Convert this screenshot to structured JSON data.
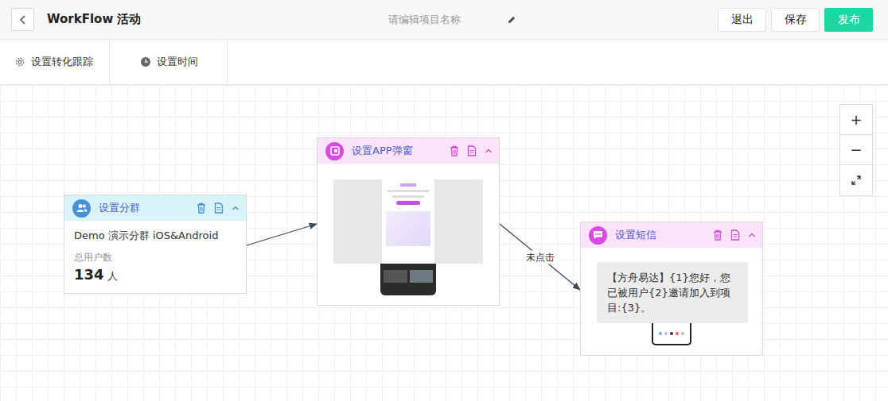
{
  "topbar": {
    "title": "WorkFlow 活动",
    "project_name_placeholder": "请编辑项目名称",
    "buttons": [
      {
        "label": "退出",
        "primary": false
      },
      {
        "label": "保存",
        "primary": false
      },
      {
        "label": "发布",
        "primary": true
      }
    ]
  },
  "toolbar": [
    {
      "label": "设置转化跟踪",
      "kind": "gear"
    },
    {
      "label": "设置时间",
      "kind": "clock"
    }
  ],
  "zoom_controls": {
    "zoom_in": "+",
    "zoom_out": "−"
  },
  "nodes": [
    {
      "kind": "segment",
      "title": "设置分群",
      "color": "#4a90d9",
      "expanded": true,
      "segment_name": "Demo 演示分群 iOS&Android",
      "metric_label": "总用户数",
      "metric_value": "134",
      "metric_unit": "人"
    },
    {
      "kind": "popup",
      "title": "设置APP弹窗",
      "color": "#d84ae0",
      "expanded": true
    },
    {
      "kind": "sms",
      "title": "设置短信",
      "color": "#d84ae0",
      "expanded": true,
      "message": "【方舟易达】{1}您好，您已被用户{2}邀请加入到项目:{3}。"
    }
  ],
  "edges": [
    {
      "from": 0,
      "to": 1
    },
    {
      "from": 1,
      "to": 2,
      "label": "未点击"
    }
  ]
}
